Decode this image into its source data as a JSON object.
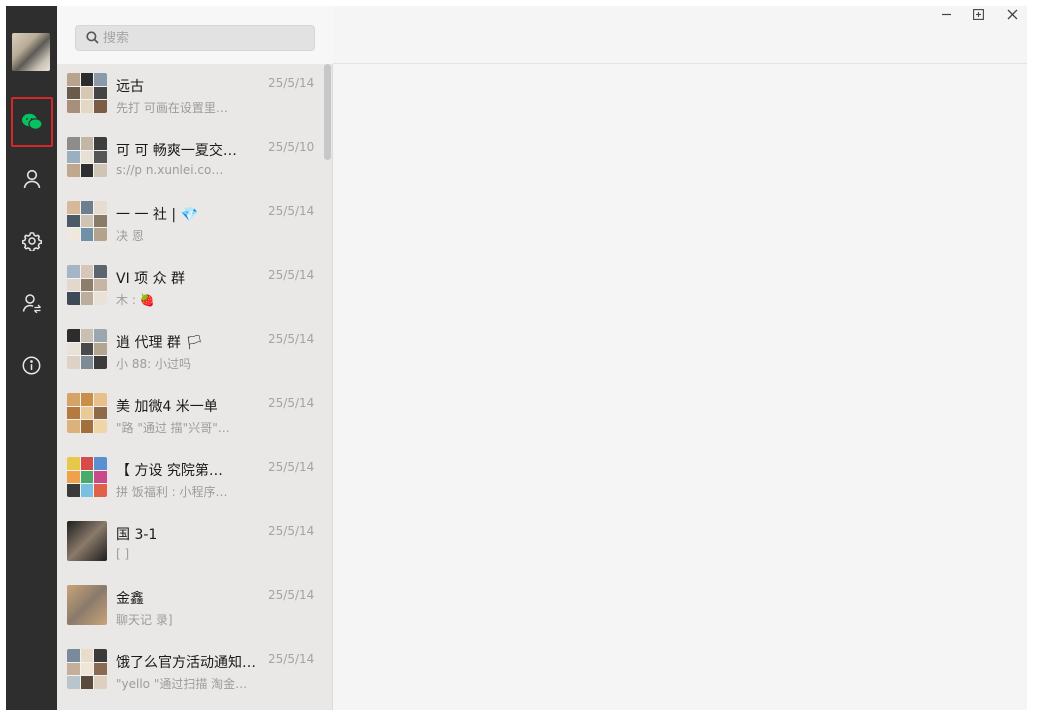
{
  "window_controls": {
    "minimize": "—",
    "maximize": "⊞",
    "close": "✕"
  },
  "search": {
    "placeholder": "搜索"
  },
  "sidebar": {
    "items": [
      {
        "name": "chat",
        "icon": "chat-bubbles-icon",
        "active": true
      },
      {
        "name": "contacts",
        "icon": "person-icon"
      },
      {
        "name": "settings",
        "icon": "gear-icon"
      },
      {
        "name": "account",
        "icon": "user-switch-icon"
      },
      {
        "name": "about",
        "icon": "info-icon"
      }
    ]
  },
  "conversations": [
    {
      "name": "远古",
      "preview": "先打 可画在设置里…",
      "date": "25/5/14",
      "avatar": [
        "#b6a48e",
        "#2c2c2c",
        "#8a9aa8",
        "#6a5a4a",
        "#d9c7b5",
        "#444",
        "#a78f7c",
        "#e4d7c5",
        "#7b5c45"
      ]
    },
    {
      "name": "可 可 畅爽一夏交…",
      "preview": "s://p n.xunlei.co…",
      "date": "25/5/10",
      "avatar": [
        "#8c8c8c",
        "#c4b6a6",
        "#3d3d3d",
        "#9ab0c0",
        "#e8e0d4",
        "#565656",
        "#bfa88e",
        "#2f2f2f",
        "#d0c4b5"
      ]
    },
    {
      "name": "一 一 社 | 💎",
      "preview": "决 恩",
      "date": "25/5/14",
      "avatar": [
        "#d5b99a",
        "#6d7f8e",
        "#e6dccf",
        "#4c5a66",
        "#cfc4b3",
        "#8a7a68",
        "#f0e8dc",
        "#7090a8",
        "#b5a28c"
      ]
    },
    {
      "name": "VI 项 众 群",
      "preview": "木 : 🍓",
      "date": "25/5/14",
      "avatar": [
        "#a4b6c6",
        "#d6c7b8",
        "#5a6570",
        "#e2d8cc",
        "#8f7d6b",
        "#c5b5a2",
        "#3e4a55",
        "#bcae9c",
        "#e9e2d8"
      ]
    },
    {
      "name": "逍 代理 群 🏳",
      "preview": "小 88: 小过吗",
      "date": "25/5/14",
      "avatar": [
        "#2d2d2d",
        "#c9c0b3",
        "#9aa6b0",
        "#e8e2d9",
        "#4a4a4a",
        "#b4a591",
        "#dcd3c6",
        "#7e8a94",
        "#3b3b3b"
      ]
    },
    {
      "name": "美 加微4 米一单",
      "preview": "\"路 \"通过 描\"兴哥\"…",
      "date": "25/5/14",
      "avatar": [
        "#d4a368",
        "#c98f4a",
        "#e7c08c",
        "#b57a3e",
        "#e9c996",
        "#8e6a48",
        "#dcb27c",
        "#a36f3b",
        "#f0d5ab"
      ]
    },
    {
      "name": "【 方设 究院第…",
      "preview": "拼 饭福利 : 小程序…",
      "date": "25/5/14",
      "avatar": [
        "#e8c84a",
        "#d74b4b",
        "#5a8fd0",
        "#f0a24a",
        "#4aaa6a",
        "#c84a8a",
        "#3a3a3a",
        "#7ac0e0",
        "#e0604a"
      ]
    },
    {
      "name": "国 3-1",
      "preview": "[ ]",
      "date": "25/5/14",
      "avatar": [
        "#1e1e1e"
      ],
      "single": true
    },
    {
      "name": "金鑫",
      "preview": "聊天记 录]",
      "date": "25/5/14",
      "avatar": [
        "#c9a47a"
      ],
      "single": true
    },
    {
      "name": "饿了么官方活动通知…",
      "preview": "\"yello \"通过扫描 淘金…",
      "date": "25/5/14",
      "avatar": [
        "#7a8a9a",
        "#e8dccc",
        "#3a3a3a",
        "#c4b09a",
        "#f0e6d8",
        "#8a6a50",
        "#b9c4cc",
        "#5a4a3c",
        "#ddd0bf"
      ]
    }
  ]
}
